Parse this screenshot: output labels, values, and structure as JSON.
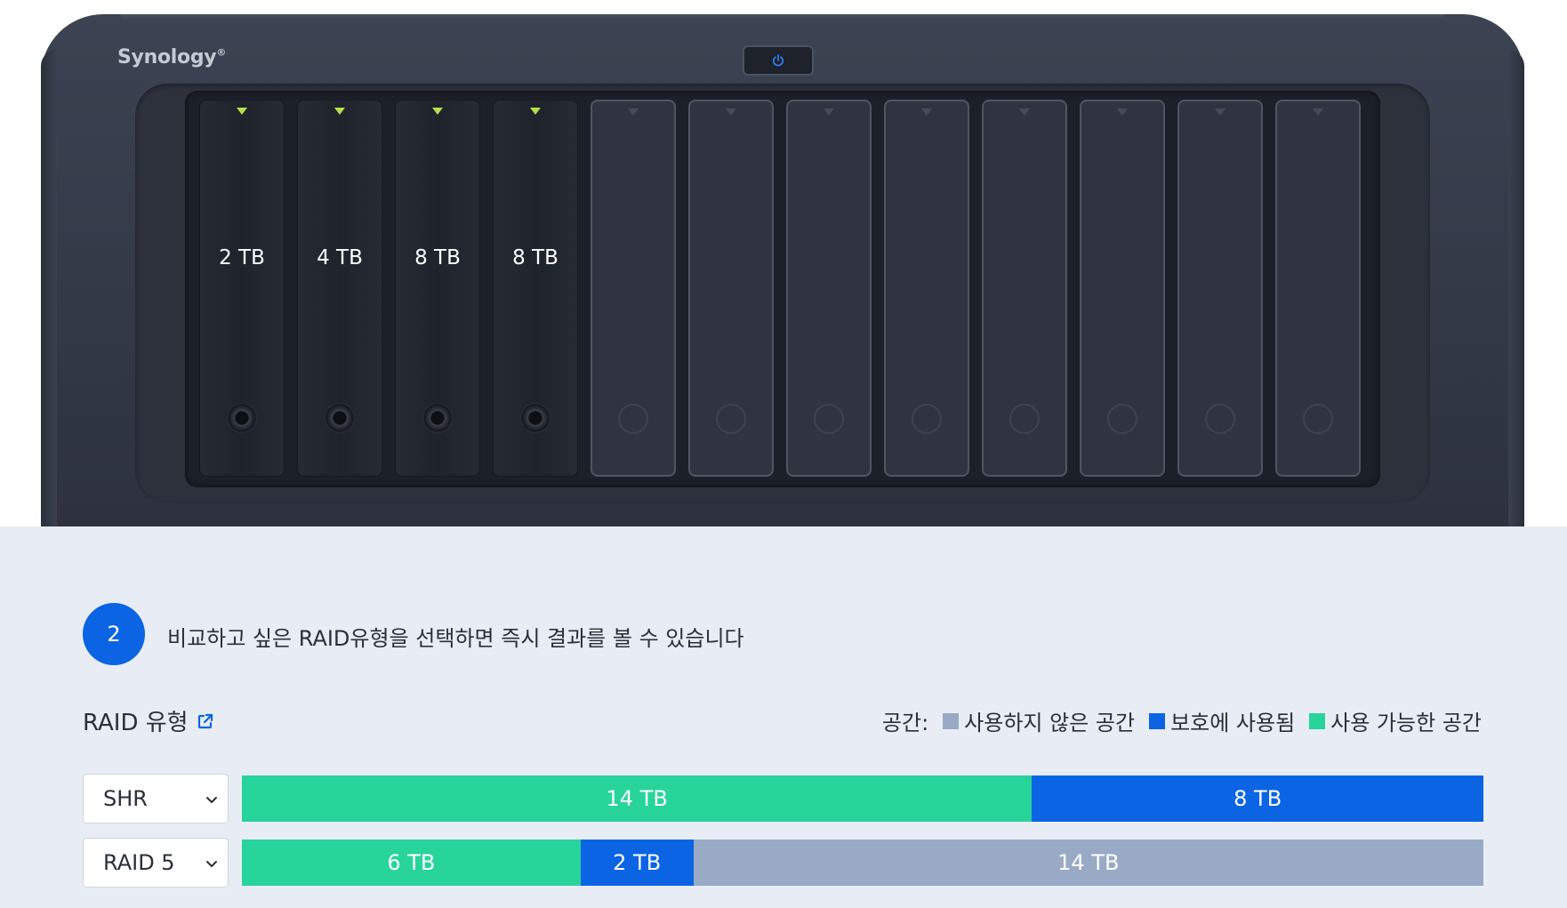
{
  "device": {
    "brand": "Synology",
    "brand_mark": "®",
    "drives": [
      {
        "capacity": "2 TB",
        "installed": true
      },
      {
        "capacity": "4 TB",
        "installed": true
      },
      {
        "capacity": "8 TB",
        "installed": true
      },
      {
        "capacity": "8 TB",
        "installed": true
      },
      {
        "capacity": "",
        "installed": false
      },
      {
        "capacity": "",
        "installed": false
      },
      {
        "capacity": "",
        "installed": false
      },
      {
        "capacity": "",
        "installed": false
      },
      {
        "capacity": "",
        "installed": false
      },
      {
        "capacity": "",
        "installed": false
      },
      {
        "capacity": "",
        "installed": false
      },
      {
        "capacity": "",
        "installed": false
      }
    ]
  },
  "step": {
    "number": "2",
    "text": "비교하고 싶은 RAID유형을 선택하면 즉시 결과를 볼 수 있습니다"
  },
  "raid_section": {
    "title": "RAID 유형",
    "link_icon": "external-link-icon"
  },
  "legend": {
    "label": "공간:",
    "items": [
      {
        "label": "사용하지 않은 공간",
        "color": "#98aac6"
      },
      {
        "label": "보호에 사용됨",
        "color": "#0a64e4"
      },
      {
        "label": "사용 가능한 공간",
        "color": "#27d49a"
      }
    ]
  },
  "colors": {
    "available": "#27d49a",
    "protection": "#0a64e4",
    "unused": "#98aac6",
    "accent": "#0a64e4"
  },
  "rows": [
    {
      "raid_type": "SHR",
      "segments": [
        {
          "kind": "available",
          "label": "14 TB",
          "tb": 14
        },
        {
          "kind": "protection",
          "label": "8 TB",
          "tb": 8
        }
      ]
    },
    {
      "raid_type": "RAID 5",
      "segments": [
        {
          "kind": "available",
          "label": "6 TB",
          "tb": 6
        },
        {
          "kind": "protection",
          "label": "2 TB",
          "tb": 2
        },
        {
          "kind": "unused",
          "label": "14 TB",
          "tb": 14
        }
      ]
    }
  ]
}
